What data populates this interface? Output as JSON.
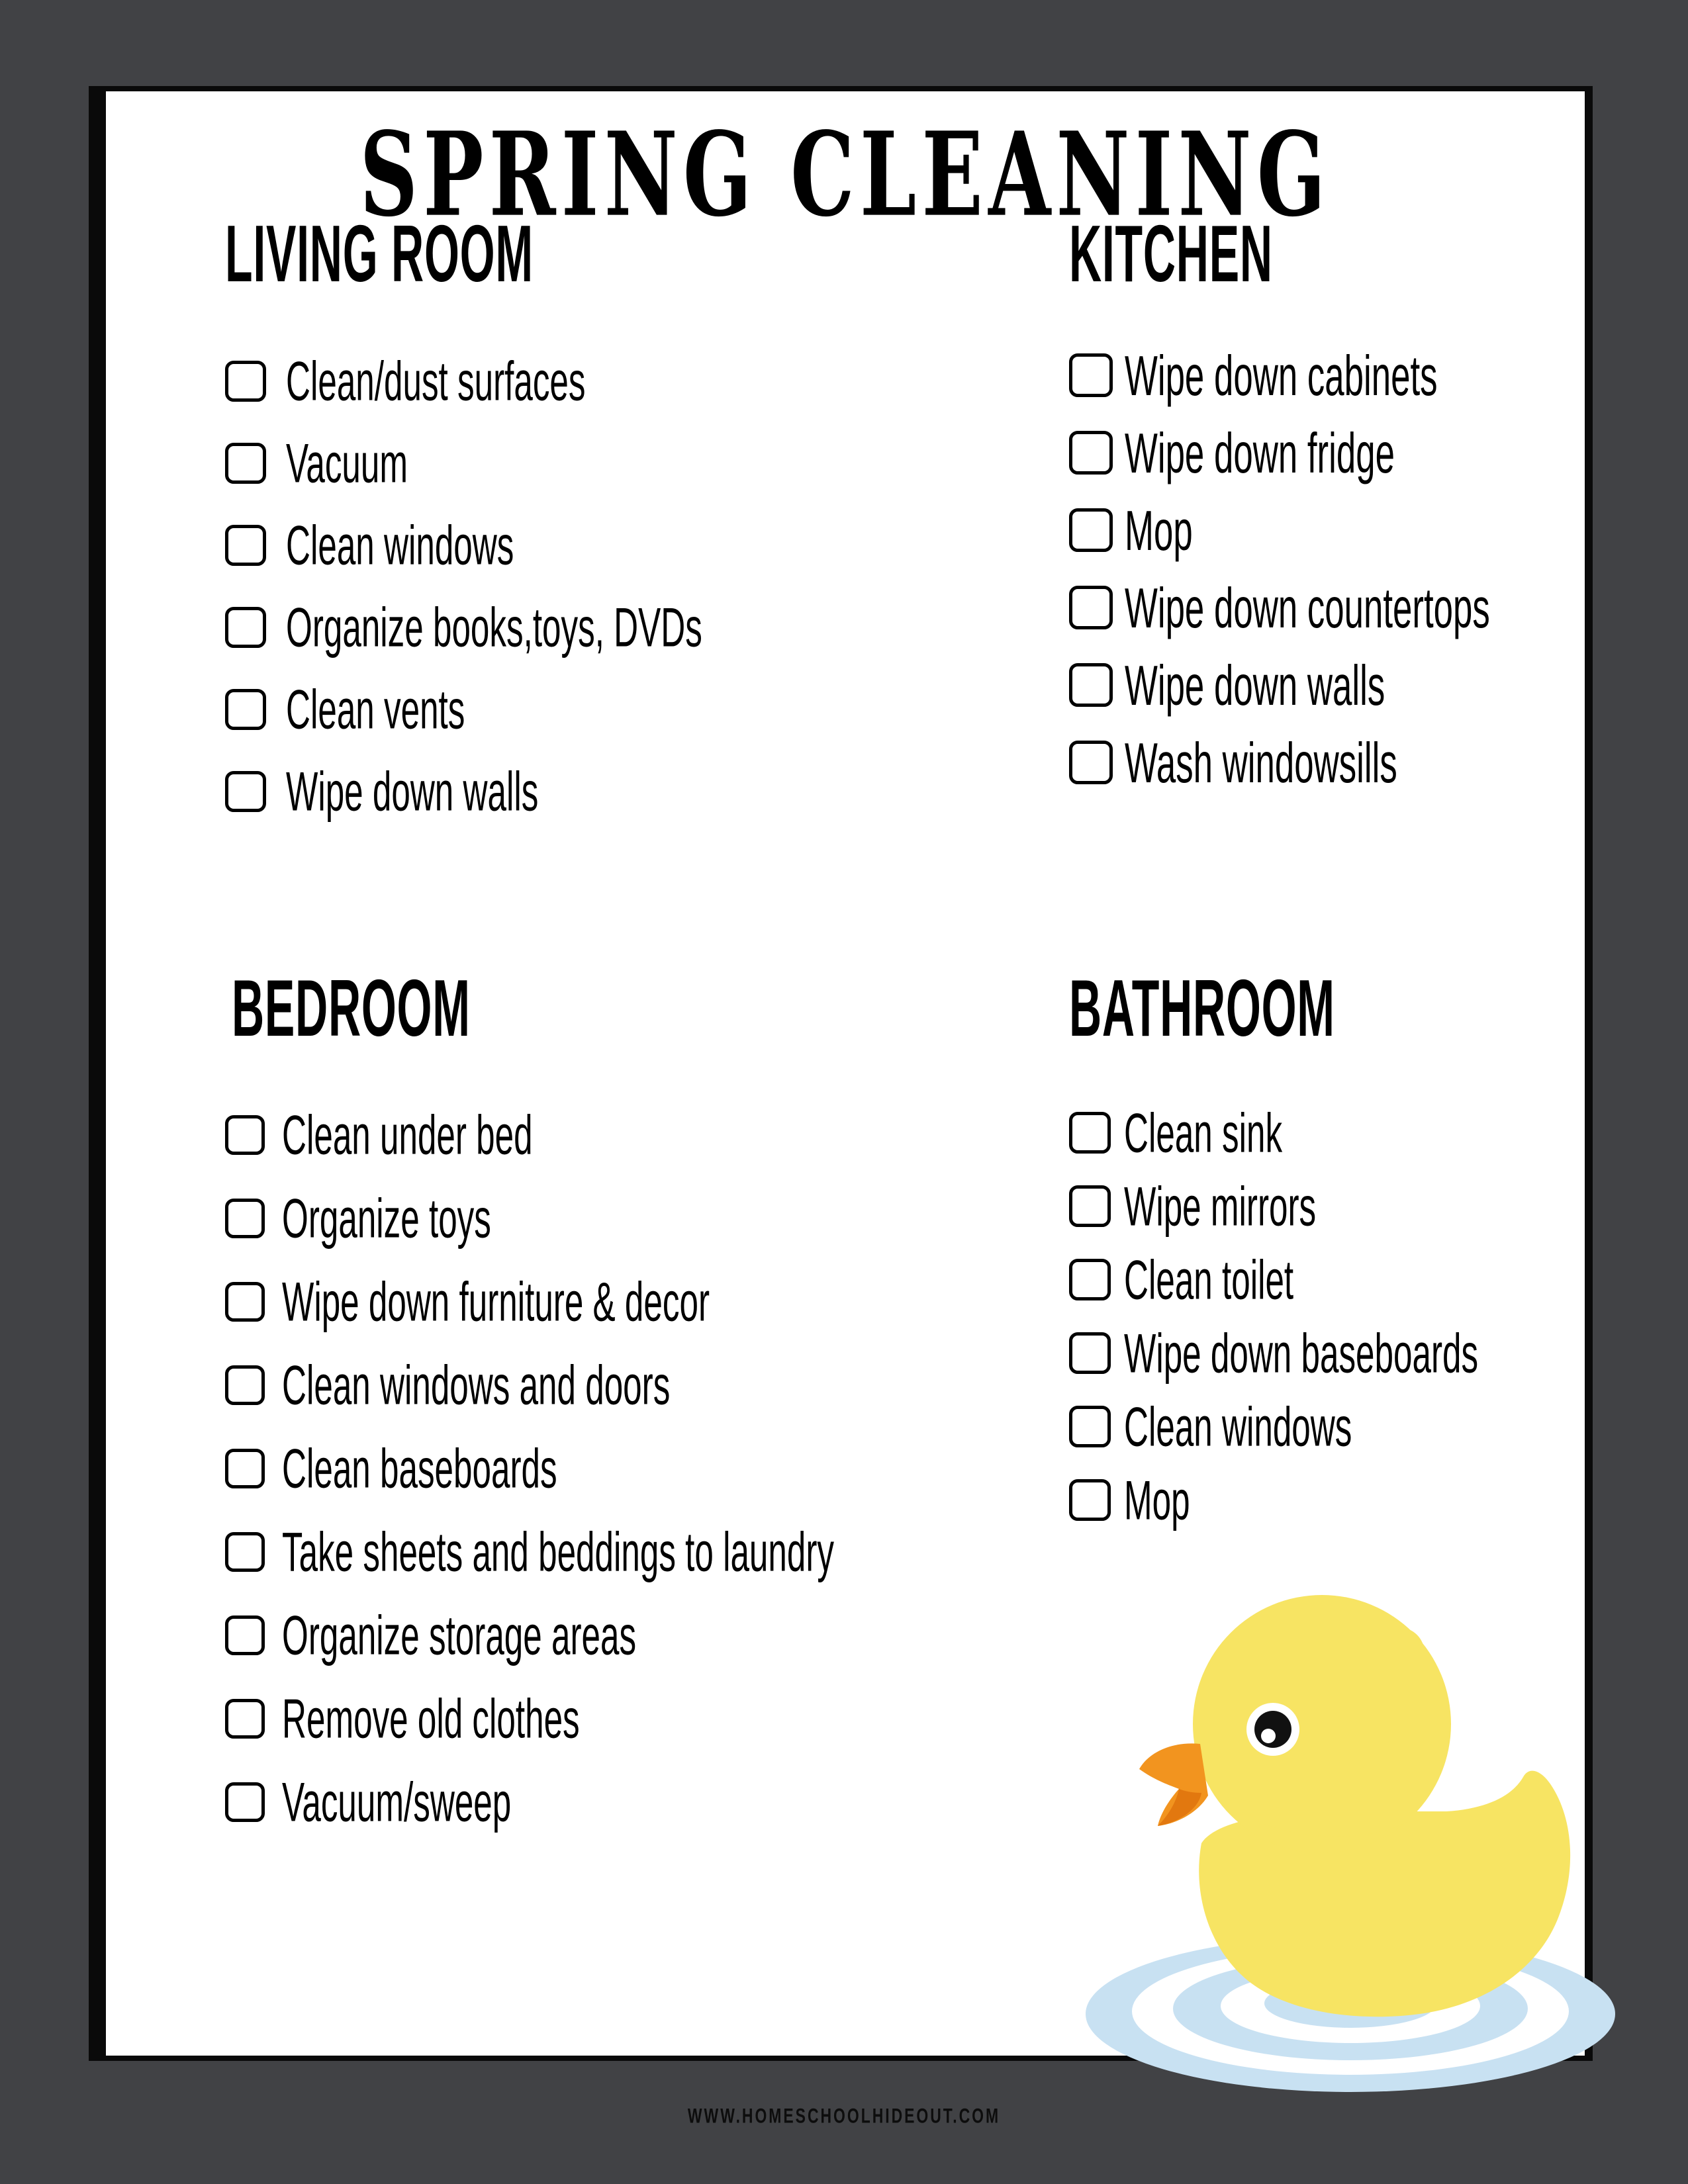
{
  "page": {
    "title": "SPRING CLEANING",
    "footer": "WWW.HOMESCHOOLHIDEOUT.COM",
    "background_color": "#414245",
    "paper_color": "#ffffff",
    "border_color": "#0a0a0a"
  },
  "sections": {
    "living_room": {
      "heading": "LIVING ROOM",
      "items": [
        "Clean/dust surfaces",
        "Vacuum",
        "Clean windows",
        "Organize books,toys, DVDs",
        "Clean vents",
        "Wipe down walls"
      ]
    },
    "kitchen": {
      "heading": "KITCHEN",
      "items": [
        "Wipe down cabinets",
        "Wipe down fridge",
        "Mop",
        "Wipe down countertops",
        "Wipe down walls",
        "Wash windowsills"
      ]
    },
    "bedroom": {
      "heading": "BEDROOM",
      "items": [
        "Clean under bed",
        "Organize toys",
        "Wipe down furniture & decor",
        "Clean windows and doors",
        "Clean baseboards",
        "Take sheets and beddings to laundry",
        "Organize storage areas",
        "Remove old clothes",
        "Vacuum/sweep"
      ]
    },
    "bathroom": {
      "heading": "BATHROOM",
      "items": [
        "Clean sink",
        "Wipe mirrors",
        "Clean toilet",
        "Wipe down baseboards",
        "Clean windows",
        "Mop"
      ]
    }
  },
  "illustration": {
    "name": "rubber-duck",
    "body_color": "#F7E463",
    "beak_color": "#F2941F",
    "beak_shadow_color": "#E2780F",
    "eye_color": "#111111",
    "eye_ring_color": "#ffffff",
    "water_color": "#C8E1F2"
  }
}
